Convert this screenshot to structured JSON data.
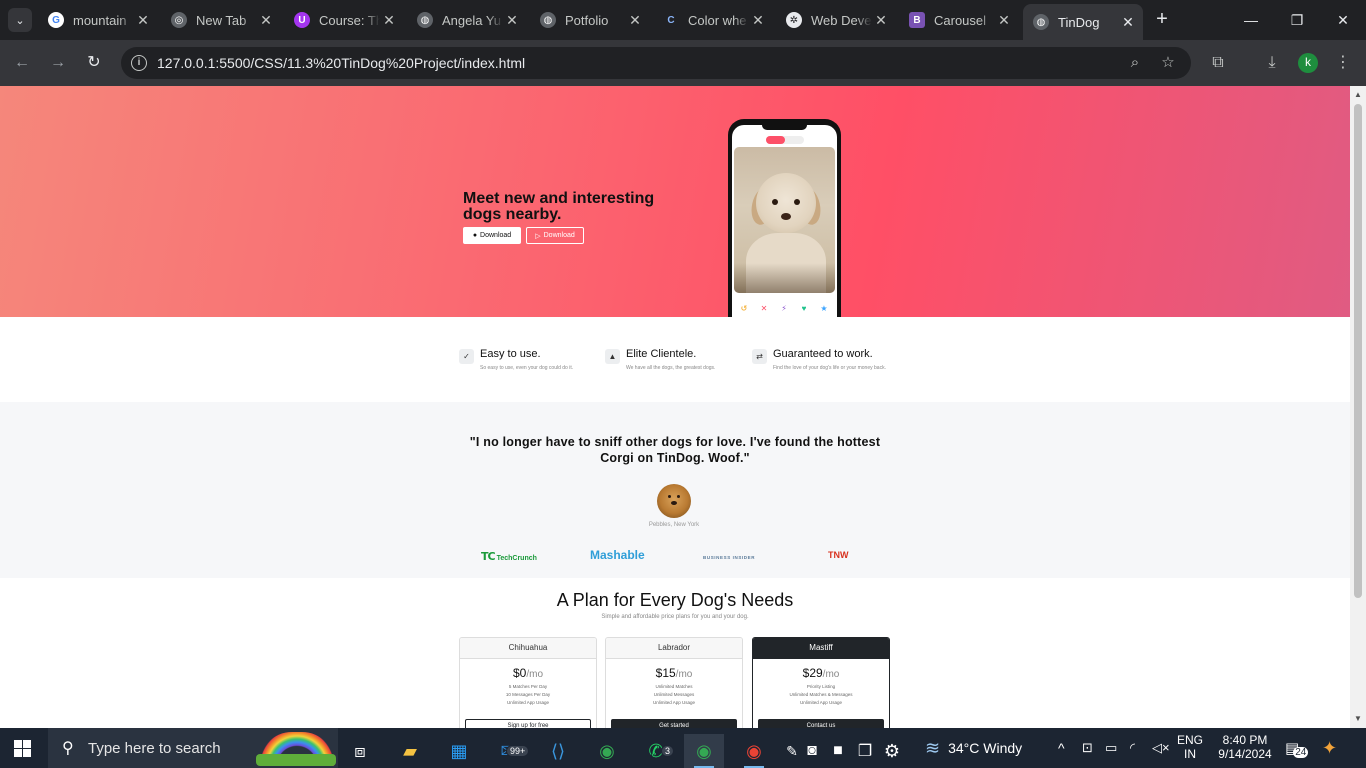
{
  "browser": {
    "tabs": [
      {
        "title": "mountain",
        "favicon": "google-icon",
        "color": "#4285f4"
      },
      {
        "title": "New Tab",
        "favicon": "chrome-icon",
        "color": "#9aa0a6"
      },
      {
        "title": "Course: Th",
        "favicon": "udemy-icon",
        "color": "#a435f0"
      },
      {
        "title": "Angela Yu",
        "favicon": "globe-icon",
        "color": "#9aa0a6"
      },
      {
        "title": "Potfolio",
        "favicon": "globe-icon",
        "color": "#9aa0a6"
      },
      {
        "title": "Color whe",
        "favicon": "color-wheel-icon",
        "color": "#1a73e8"
      },
      {
        "title": "Web Deve",
        "favicon": "openai-icon",
        "color": "#e8eaed"
      },
      {
        "title": "Carousel",
        "favicon": "bootstrap-icon",
        "color": "#7952b3"
      },
      {
        "title": "TinDog",
        "favicon": "globe-icon",
        "color": "#9aa0a6",
        "active": true
      }
    ],
    "url": "127.0.0.1:5500/CSS/11.3%20TinDog%20Project/index.html",
    "profile_initial": "k"
  },
  "page": {
    "hero": {
      "title": "Meet new and interesting dogs nearby.",
      "btn_apple": "Download",
      "btn_google": "Download"
    },
    "features": [
      {
        "heading": "Easy to use.",
        "text": "So easy to use, even your dog could do it.",
        "icon": "check-circle-icon"
      },
      {
        "heading": "Elite Clientele.",
        "text": "We have all the dogs, the greatest dogs.",
        "icon": "graduation-cap-icon"
      },
      {
        "heading": "Guaranteed to work.",
        "text": "Find the love of your dog's life or your money back.",
        "icon": "arrows-cycle-icon"
      }
    ],
    "testimonial": {
      "quote": "\"I no longer have to sniff other dogs for love. I've found the hottest Corgi on TinDog. Woof.\"",
      "caption": "Pebbles, New York"
    },
    "press": {
      "techcrunch": "TechCrunch",
      "mashable": "Mashable",
      "business_insider": "BUSINESS INSIDER",
      "tnw": "TNW"
    },
    "pricing": {
      "title": "A Plan for Every Dog's Needs",
      "subtitle": "Simple and affordable price plans for you and your dog.",
      "plans": [
        {
          "name": "Chihuahua",
          "price": "$0",
          "period": "/mo",
          "features": [
            "5 Matches Per Day",
            "10 Messages Per Day",
            "Unlimited App Usage"
          ],
          "button": "Sign up for free"
        },
        {
          "name": "Labrador",
          "price": "$15",
          "period": "/mo",
          "features": [
            "Unlimited Matches",
            "Unlimited Messages",
            "Unlimited App Usage"
          ],
          "button": "Get started"
        },
        {
          "name": "Mastiff",
          "price": "$29",
          "period": "/mo",
          "features": [
            "Priority Listing",
            "Unlimited Matches & Messages",
            "Unlimited App Usage"
          ],
          "button": "Contact us"
        }
      ]
    }
  },
  "taskbar": {
    "search_placeholder": "Type here to search",
    "outlook_badge": "99+",
    "whatsapp_badge": "3",
    "weather": "34°C  Windy",
    "lang_top": "ENG",
    "lang_bottom": "IN",
    "time": "8:40 PM",
    "date": "9/14/2024",
    "notif_count": "24"
  }
}
